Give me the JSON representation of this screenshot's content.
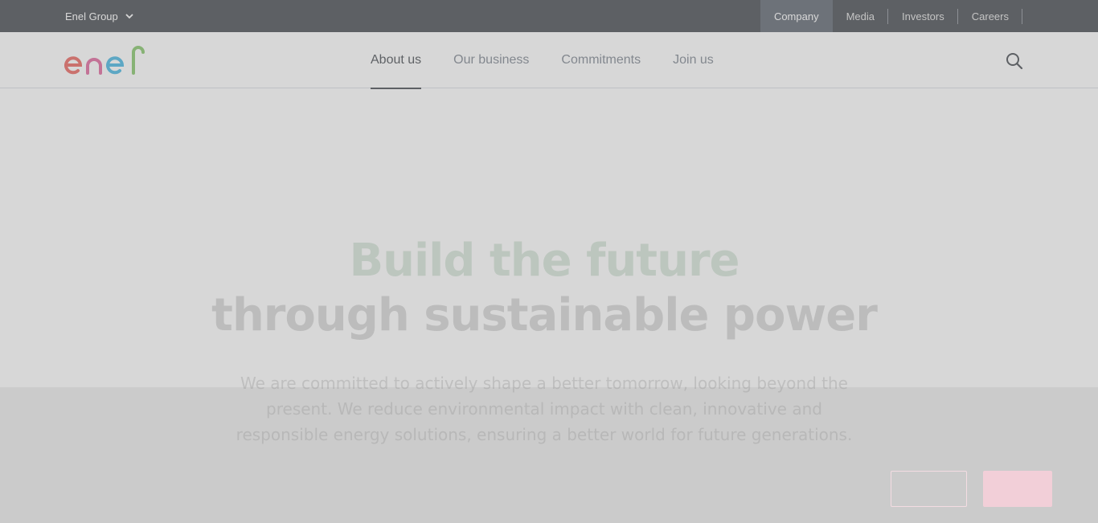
{
  "topbar": {
    "group_label": "Enel Group",
    "links": [
      {
        "label": "Company",
        "active": true
      },
      {
        "label": "Media",
        "active": false
      },
      {
        "label": "Investors",
        "active": false
      },
      {
        "label": "Careers",
        "active": false
      }
    ]
  },
  "header": {
    "logo_text": "enel",
    "nav": [
      {
        "label": "About us",
        "active": true
      },
      {
        "label": "Our business",
        "active": false
      },
      {
        "label": "Commitments",
        "active": false
      },
      {
        "label": "Join us",
        "active": false
      }
    ],
    "search_icon": "search-icon"
  },
  "hero": {
    "title_line1": "Build the future",
    "title_line2": "through sustainable power",
    "description": "We are committed to actively shape a better tomorrow, looking beyond the present. We reduce environmental impact with clean, innovative and responsible energy solutions, ensuring a better world for future generations."
  },
  "cookie_banner": {
    "secondary_button_label": "",
    "primary_button_label": ""
  },
  "colors": {
    "topbar_bg": "#0b1118",
    "topbar_active": "#2b3443",
    "logo_red": "#e4322b",
    "logo_pink": "#d6357d",
    "logo_blue": "#0a9fd8",
    "logo_green": "#5fb53a"
  }
}
